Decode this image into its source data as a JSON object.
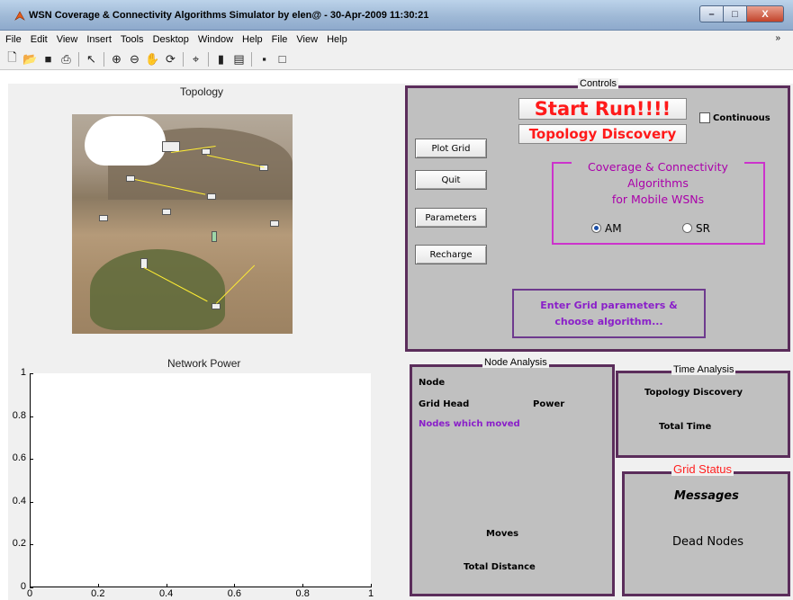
{
  "window": {
    "title": "WSN Coverage & Connectivity Algorithms Simulator by elen@  -  30-Apr-2009 11:30:21",
    "minimize": "–",
    "maximize": "□",
    "close": "X"
  },
  "menu": [
    "File",
    "Edit",
    "View",
    "Insert",
    "Tools",
    "Desktop",
    "Window",
    "Help",
    "File",
    "View",
    "Help"
  ],
  "toolbar_icons": [
    "new-file-icon",
    "open-folder-icon",
    "save-icon",
    "print-icon",
    "pointer-icon",
    "zoom-in-icon",
    "zoom-out-icon",
    "pan-hand-icon",
    "rotate-icon",
    "data-cursor-icon",
    "colorbar-icon",
    "legend-icon",
    "hide-plot-tools-icon",
    "show-plot-tools-icon"
  ],
  "topology": {
    "title": "Topology"
  },
  "network_power": {
    "title": "Network Power",
    "chart_data": {
      "type": "line",
      "title": "Network Power",
      "xlabel": "",
      "ylabel": "",
      "xlim": [
        0,
        1
      ],
      "ylim": [
        0,
        1
      ],
      "x_ticks": [
        "0",
        "0.2",
        "0.4",
        "0.6",
        "0.8",
        "1"
      ],
      "y_ticks": [
        "0",
        "0.2",
        "0.4",
        "0.6",
        "0.8",
        "1"
      ],
      "series": []
    }
  },
  "controls": {
    "title": "Controls",
    "start_run": "Start Run!!!!",
    "topology_discovery": "Topology Discovery",
    "continuous": "Continuous",
    "plot_grid": "Plot Grid",
    "quit": "Quit",
    "parameters": "Parameters",
    "recharge": "Recharge",
    "algo_title_1": "Coverage & Connectivity",
    "algo_title_2": "Algorithms",
    "algo_title_3": "for Mobile WSNs",
    "radio_am": "AM",
    "radio_sr": "SR",
    "status_1": "Enter Grid parameters &",
    "status_2": "choose algorithm..."
  },
  "node_analysis": {
    "title": "Node Analysis",
    "node": "Node",
    "grid_head": "Grid Head",
    "power": "Power",
    "nodes_moved": "Nodes which moved",
    "moves": "Moves",
    "total_distance": "Total Distance"
  },
  "time_analysis": {
    "title": "Time Analysis",
    "topology_discovery": "Topology Discovery",
    "total_time": "Total Time"
  },
  "grid_status": {
    "title": "Grid Status",
    "messages": "Messages",
    "dead_nodes": "Dead Nodes"
  },
  "colors": {
    "panel_border": "#5b2d5b",
    "panel_bg": "#c0c0c0",
    "start_text": "#ff1a1a",
    "algo_magenta": "#cc33cc",
    "status_purple": "#8a1fc9"
  }
}
